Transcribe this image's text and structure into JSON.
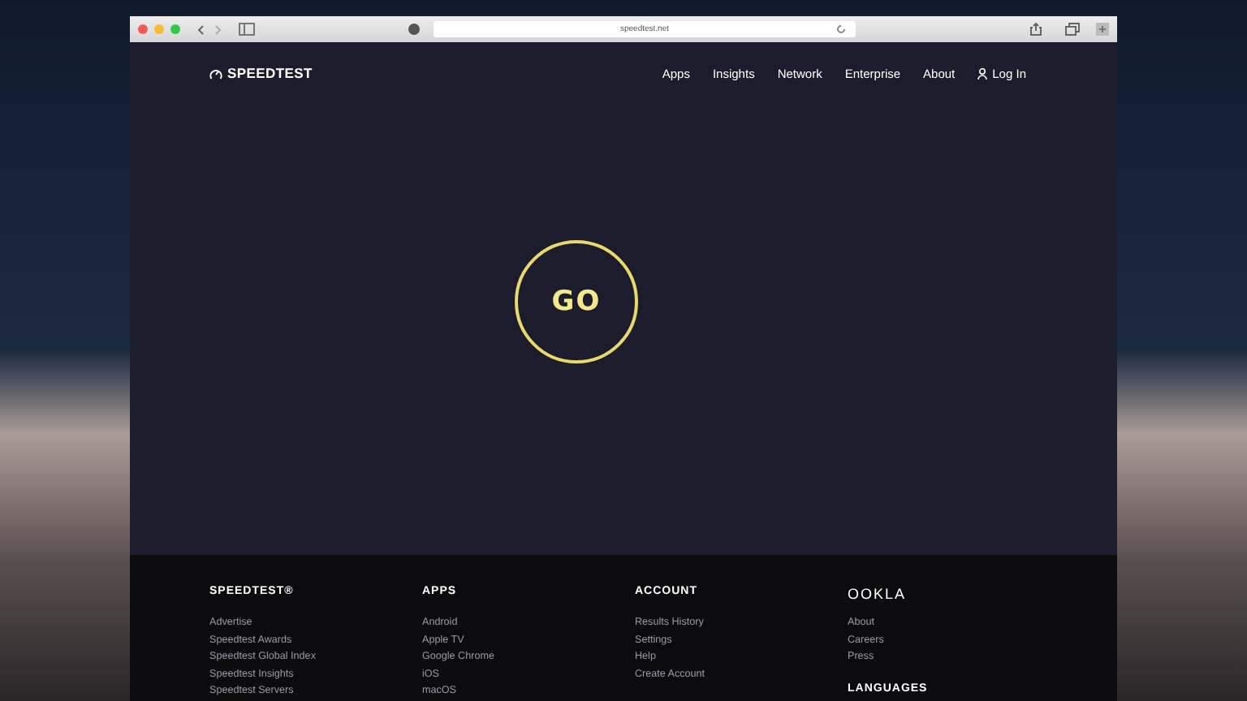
{
  "browser": {
    "url": "speedtest.net"
  },
  "header": {
    "logo": "SPEEDTEST",
    "nav": [
      "Apps",
      "Insights",
      "Network",
      "Enterprise",
      "About"
    ],
    "login": "Log In"
  },
  "main": {
    "go_button": "GO"
  },
  "footer": {
    "columns": [
      {
        "title": "SPEEDTEST®",
        "links": [
          "Advertise",
          "Speedtest Awards",
          "Speedtest Global Index",
          "Speedtest Insights",
          "Speedtest Servers"
        ]
      },
      {
        "title": "APPS",
        "links": [
          "Android",
          "Apple TV",
          "Google Chrome",
          "iOS",
          "macOS"
        ]
      },
      {
        "title": "ACCOUNT",
        "links": [
          "Results History",
          "Settings",
          "Help",
          "Create Account"
        ]
      },
      {
        "title": "OOKLA",
        "links": [
          "About",
          "Careers",
          "Press"
        ],
        "subtitle": "LANGUAGES"
      }
    ]
  }
}
